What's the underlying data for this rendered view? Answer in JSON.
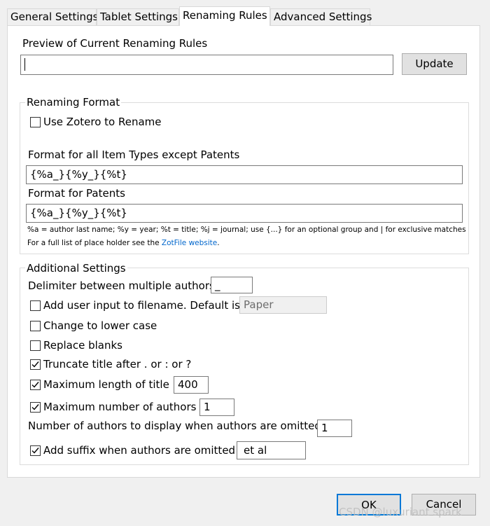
{
  "tabs": [
    {
      "label": "General Settings",
      "active": false
    },
    {
      "label": "Tablet Settings",
      "active": false
    },
    {
      "label": "Renaming Rules",
      "active": true
    },
    {
      "label": "Advanced Settings",
      "active": false
    }
  ],
  "preview": {
    "label": "Preview of Current Renaming Rules",
    "value": "",
    "update_button": "Update"
  },
  "renaming_format": {
    "title": "Renaming Format",
    "use_zotero": {
      "label": "Use Zotero to Rename",
      "checked": false
    },
    "format_all_label": "Format for all Item Types except Patents",
    "format_all_value": "{%a_}{%y_}{%t}",
    "format_patents_label": "Format for Patents",
    "format_patents_value": "{%a_}{%y_}{%t}",
    "help_line1": "%a = author last name; %y = year; %t = title; %j = journal; use {...} for an optional group and | for exclusive matches",
    "help_line2_prefix": "For a full list of place holder see the ",
    "help_link": "ZotFile website",
    "help_line2_suffix": "."
  },
  "additional": {
    "title": "Additional Settings",
    "delimiter_label": "Delimiter between multiple authors",
    "delimiter_value": "_",
    "user_input": {
      "label": "Add user input to filename. Default is",
      "checked": false,
      "value": "Paper"
    },
    "lower_case": {
      "label": "Change to lower case",
      "checked": false
    },
    "replace_blanks": {
      "label": "Replace blanks",
      "checked": false
    },
    "truncate": {
      "label": "Truncate title after . or : or ?",
      "checked": true
    },
    "max_title": {
      "label": "Maximum length of title",
      "checked": true,
      "value": "400"
    },
    "max_authors": {
      "label": "Maximum number of authors",
      "checked": true,
      "value": "1"
    },
    "num_authors_omitted_label": "Number of authors to display when authors are omitted",
    "num_authors_omitted_value": "1",
    "suffix": {
      "label": "Add suffix when authors are omitted",
      "checked": true,
      "value": "et al"
    }
  },
  "footer": {
    "ok": "OK",
    "cancel": "Cancel"
  },
  "watermark": "CSDN @luxuriant spark"
}
